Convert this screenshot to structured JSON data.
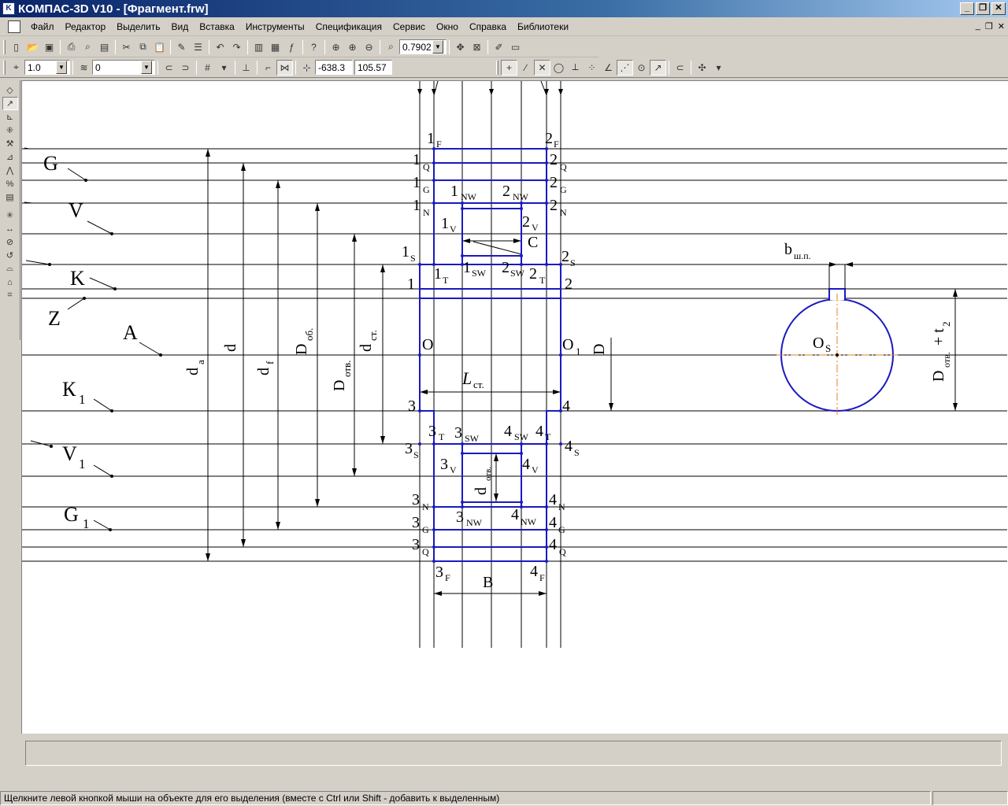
{
  "window": {
    "title": "КОМПАС-3D V10 - [Фрагмент.frw]",
    "app_icon_text": "K"
  },
  "menu": [
    "Файл",
    "Редактор",
    "Выделить",
    "Вид",
    "Вставка",
    "Инструменты",
    "Спецификация",
    "Сервис",
    "Окно",
    "Справка",
    "Библиотеки"
  ],
  "toolbar_standard": {
    "zoom_value": "0.7902"
  },
  "toolbar_current": {
    "step_value": "1.0",
    "layer_value": "0",
    "coord_x": "-638.3",
    "coord_y": "105.57"
  },
  "status": {
    "message": "Щелкните левой кнопкой мыши на объекте для его выделения (вместе с Ctrl или Shift - добавить к выделенным)"
  },
  "colors": {
    "drawing_lines": "#000000",
    "contour": "#0000c0",
    "axis": "#e08020",
    "background": "#ffffff"
  },
  "drawing": {
    "left_labels": [
      "G",
      "V",
      "K",
      "Z",
      "A",
      "К",
      "V",
      "G"
    ],
    "left_subscripts": [
      "1",
      "1",
      "1"
    ],
    "dimension_labels": [
      "d",
      "a",
      "d",
      "d",
      "f",
      "D",
      "об.",
      "D",
      "отв.",
      "d",
      "ст.",
      "D"
    ],
    "hub_labels": {
      "top_left": [
        "1",
        "F",
        "1",
        "Q",
        "1",
        "G",
        "1",
        "N",
        "1",
        "S",
        "1",
        "1",
        "V",
        "1",
        "T",
        "1",
        "SW",
        "1",
        "NW"
      ],
      "top_right": [
        "2",
        "F",
        "2",
        "Q",
        "2",
        "G",
        "2",
        "N",
        "2",
        "S",
        "2",
        "2",
        "V",
        "2",
        "T",
        "2",
        "SW",
        "2",
        "NW"
      ],
      "bottom_left": [
        "3",
        "F",
        "3",
        "Q",
        "3",
        "G",
        "3",
        "N",
        "3",
        "S",
        "3",
        "3",
        "V",
        "3",
        "T",
        "3",
        "SW",
        "3",
        "NW"
      ],
      "bottom_right": [
        "4",
        "F",
        "4",
        "Q",
        "4",
        "G",
        "4",
        "N",
        "4",
        "S",
        "4",
        "4",
        "V",
        "4",
        "T",
        "4",
        "SW",
        "4",
        "NW"
      ],
      "center": [
        "O",
        "O",
        "1",
        "L",
        "ст.",
        "C",
        "B",
        "d",
        "отв."
      ]
    },
    "bore_labels": [
      "b",
      "ш.п.",
      "O",
      "S",
      "D",
      "отв.",
      "+ t",
      "2"
    ]
  }
}
